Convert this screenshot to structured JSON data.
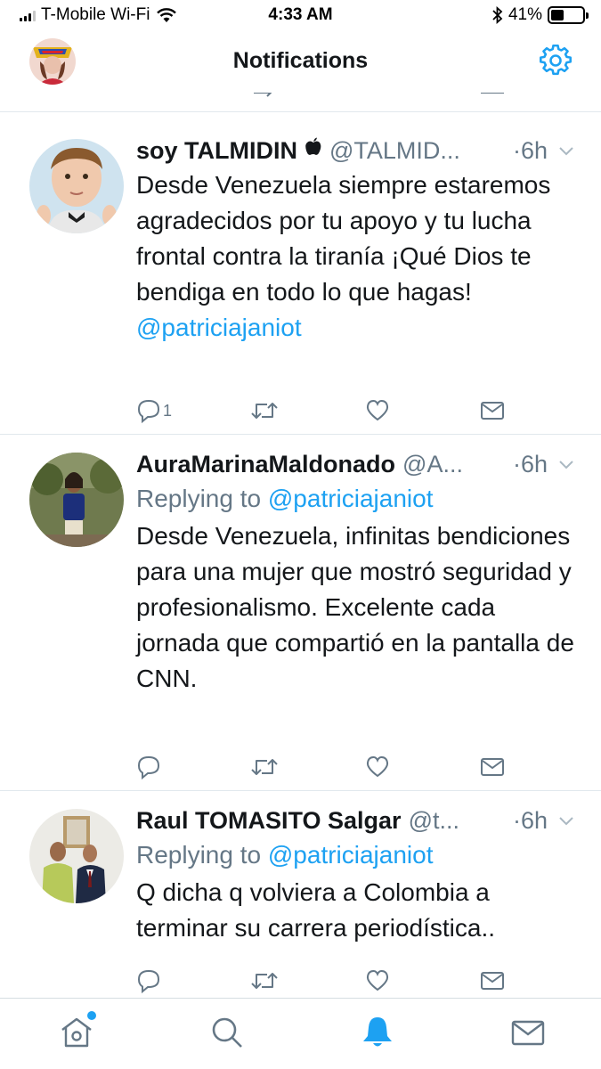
{
  "status_bar": {
    "carrier": "T-Mobile Wi-Fi",
    "time": "4:33 AM",
    "battery": "41%",
    "battery_level": 0.41
  },
  "header": {
    "title": "Notifications"
  },
  "tweets": [
    {
      "name": "soy TALMIDIN",
      "badge": "",
      "handle": "@TALMID...",
      "time": "·6h",
      "replying_prefix": "",
      "replying_to": "",
      "text": "Desde Venezuela siempre estaremos agradecidos por tu apoyo y tu lucha frontal contra la tiranía ¡Qué Dios te bendiga en todo lo que hagas!",
      "mention_text": "@patriciajaniot",
      "reply_count": "1"
    },
    {
      "name": "AuraMarinaMaldonado",
      "handle": "@A...",
      "time": "·6h",
      "replying_prefix": "Replying to",
      "replying_to": "@patriciajaniot",
      "text": "Desde Venezuela, infinitas bendiciones para una mujer que mostró seguridad y profesionalismo. Excelente cada jornada que compartió en la pantalla de CNN.",
      "reply_count": ""
    },
    {
      "name": "Raul TOMASITO Salgar",
      "handle": "@t...",
      "time": "·6h",
      "replying_prefix": "Replying to",
      "replying_to": "@patriciajaniot",
      "text": "Q dicha q volviera a Colombia a terminar su carrera periodística..",
      "reply_count": ""
    }
  ],
  "icons": {
    "settings": "gear-icon",
    "reply": "reply-icon",
    "retweet": "retweet-icon",
    "like": "heart-icon",
    "dm": "envelope-icon",
    "home": "home-icon",
    "search": "search-icon",
    "notifications": "bell-icon",
    "messages": "envelope-icon"
  },
  "colors": {
    "accent": "#1da1f2",
    "text_primary": "#14171a",
    "text_secondary": "#657786",
    "divider": "#e1e8ed"
  }
}
